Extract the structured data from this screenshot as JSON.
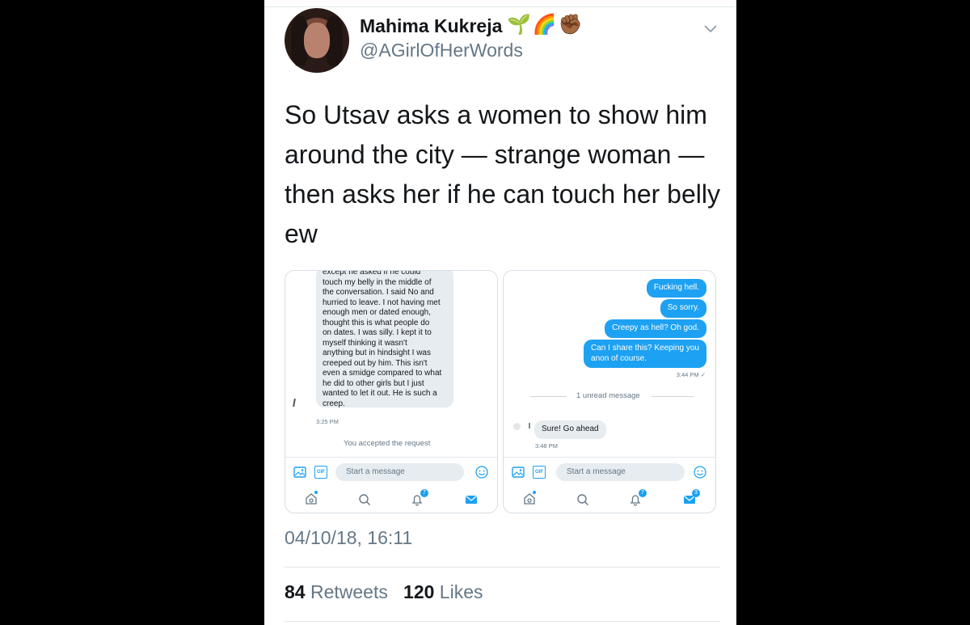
{
  "author": {
    "name": "Mahima Kukreja",
    "emojis": "🌱🌈✊🏾",
    "handle": "@AGirlOfHerWords"
  },
  "tweet": {
    "text": "So Utsav asks a women to show him around the city — strange woman — then asks her if he can touch her belly ew",
    "timestamp": "04/10/18, 16:11"
  },
  "stats": {
    "retweets_count": "84",
    "retweets_label": "Retweets",
    "likes_count": "120",
    "likes_label": "Likes"
  },
  "screenshot_left": {
    "message_lines": [
      "except he asked if he could",
      "touch my belly in the middle of",
      "the conversation. I said No and",
      "hurried to leave. I not having met",
      "enough men or dated enough,",
      "thought this is what people do",
      "on dates. I was silly. I kept it to",
      "myself thinking it wasn't",
      "anything but in hindsight I was",
      "creeped out by him. This isn't",
      "even a smidge compared to what",
      "he did to other girls but I just",
      "wanted to let it out. He is such a",
      "creep."
    ],
    "message_time": "3:25 PM",
    "notice": "You accepted the request",
    "composer_placeholder": "Start a message",
    "gif_label": "GIF",
    "notifications_badge": "7"
  },
  "screenshot_right": {
    "sent_messages": [
      "Fucking hell.",
      "So sorry.",
      "Creepy as hell? Oh god."
    ],
    "sent_multiline_lines": [
      "Can I share this? Keeping you",
      "anon of course."
    ],
    "sent_time": "3:44 PM ✓",
    "unread_divider": "1 unread message",
    "reply": "Sure! Go ahead",
    "reply_time": "3:48 PM",
    "composer_placeholder": "Start a message",
    "gif_label": "GIF",
    "notifications_badge": "7",
    "messages_badge": "3"
  },
  "colors": {
    "accent": "#1da1f2",
    "text_primary": "#14171a",
    "text_secondary": "#657786"
  }
}
